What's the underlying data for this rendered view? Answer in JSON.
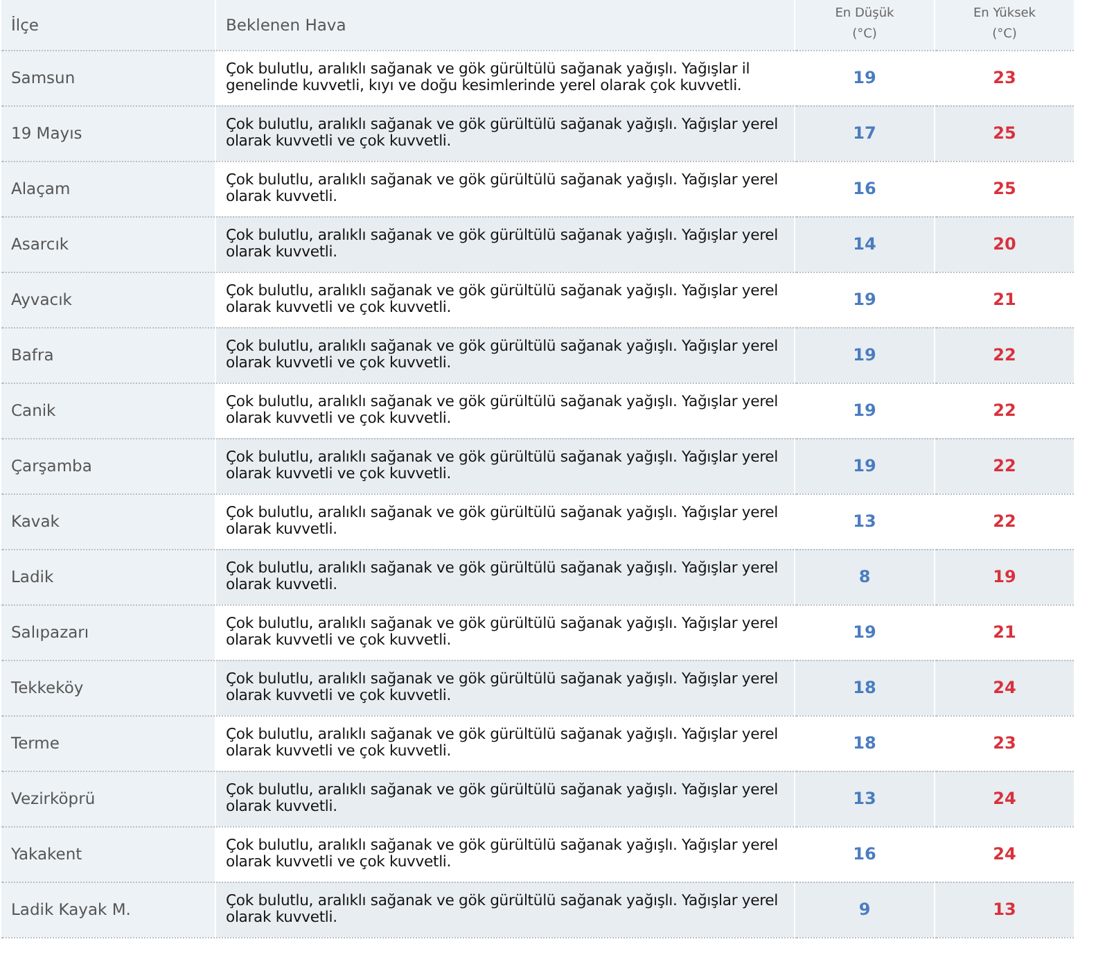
{
  "table": {
    "columns": [
      {
        "label": "İlçe",
        "kind": "text"
      },
      {
        "label": "Beklenen Hava",
        "kind": "text"
      },
      {
        "label": "En Düşük",
        "unit": "(°C)",
        "kind": "low"
      },
      {
        "label": "En Yüksek",
        "unit": "(°C)",
        "kind": "high"
      }
    ],
    "rows": [
      {
        "district": "Samsun",
        "forecast": "Çok bulutlu, aralıklı sağanak ve gök gürültülü sağanak yağışlı. Yağışlar il genelinde kuvvetli, kıyı ve doğu kesimlerinde yerel olarak çok kuvvetli.",
        "low": "19",
        "high": "23"
      },
      {
        "district": "19 Mayıs",
        "forecast": "Çok bulutlu, aralıklı sağanak ve gök gürültülü sağanak yağışlı. Yağışlar yerel olarak kuvvetli ve çok kuvvetli.",
        "low": "17",
        "high": "25"
      },
      {
        "district": "Alaçam",
        "forecast": "Çok bulutlu, aralıklı sağanak ve gök gürültülü sağanak yağışlı. Yağışlar yerel olarak kuvvetli.",
        "low": "16",
        "high": "25"
      },
      {
        "district": "Asarcık",
        "forecast": "Çok bulutlu, aralıklı sağanak ve gök gürültülü sağanak yağışlı. Yağışlar yerel olarak kuvvetli.",
        "low": "14",
        "high": "20"
      },
      {
        "district": "Ayvacık",
        "forecast": "Çok bulutlu, aralıklı sağanak ve gök gürültülü sağanak yağışlı. Yağışlar yerel olarak kuvvetli ve çok kuvvetli.",
        "low": "19",
        "high": "21"
      },
      {
        "district": "Bafra",
        "forecast": "Çok bulutlu, aralıklı sağanak ve gök gürültülü sağanak yağışlı. Yağışlar yerel olarak kuvvetli ve çok kuvvetli.",
        "low": "19",
        "high": "22"
      },
      {
        "district": "Canik",
        "forecast": "Çok bulutlu, aralıklı sağanak ve gök gürültülü sağanak yağışlı. Yağışlar yerel olarak kuvvetli ve çok kuvvetli.",
        "low": "19",
        "high": "22"
      },
      {
        "district": "Çarşamba",
        "forecast": "Çok bulutlu, aralıklı sağanak ve gök gürültülü sağanak yağışlı. Yağışlar yerel olarak kuvvetli ve çok kuvvetli.",
        "low": "19",
        "high": "22"
      },
      {
        "district": "Kavak",
        "forecast": "Çok bulutlu, aralıklı sağanak ve gök gürültülü sağanak yağışlı. Yağışlar yerel olarak kuvvetli.",
        "low": "13",
        "high": "22"
      },
      {
        "district": "Ladik",
        "forecast": "Çok bulutlu, aralıklı sağanak ve gök gürültülü sağanak yağışlı. Yağışlar yerel olarak kuvvetli.",
        "low": "8",
        "high": "19"
      },
      {
        "district": "Salıpazarı",
        "forecast": "Çok bulutlu, aralıklı sağanak ve gök gürültülü sağanak yağışlı. Yağışlar yerel olarak kuvvetli ve çok kuvvetli.",
        "low": "19",
        "high": "21"
      },
      {
        "district": "Tekkeköy",
        "forecast": "Çok bulutlu, aralıklı sağanak ve gök gürültülü sağanak yağışlı. Yağışlar yerel olarak kuvvetli ve çok kuvvetli.",
        "low": "18",
        "high": "24"
      },
      {
        "district": "Terme",
        "forecast": "Çok bulutlu, aralıklı sağanak ve gök gürültülü sağanak yağışlı. Yağışlar yerel olarak kuvvetli ve çok kuvvetli.",
        "low": "18",
        "high": "23"
      },
      {
        "district": "Vezirköprü",
        "forecast": "Çok bulutlu, aralıklı sağanak ve gök gürültülü sağanak yağışlı. Yağışlar yerel olarak kuvvetli.",
        "low": "13",
        "high": "24"
      },
      {
        "district": "Yakakent",
        "forecast": "Çok bulutlu, aralıklı sağanak ve gök gürültülü sağanak yağışlı. Yağışlar yerel olarak kuvvetli ve çok kuvvetli.",
        "low": "16",
        "high": "24"
      },
      {
        "district": "Ladik Kayak M.",
        "forecast": "Çok bulutlu, aralıklı sağanak ve gök gürültülü sağanak yağışlı. Yağışlar yerel olarak kuvvetli.",
        "low": "9",
        "high": "13"
      }
    ]
  }
}
